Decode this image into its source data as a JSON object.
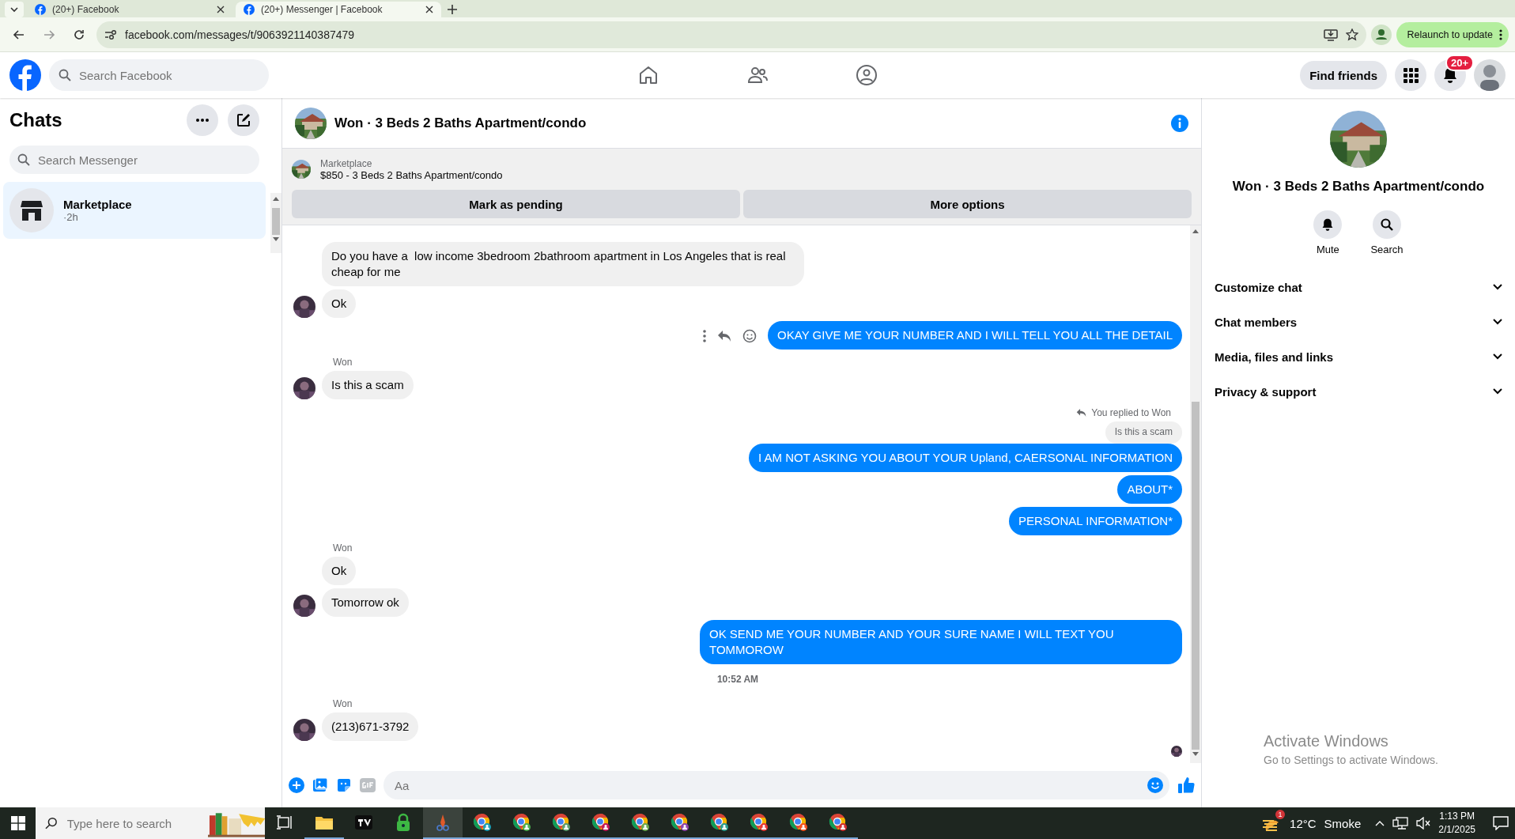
{
  "browser": {
    "tabs": [
      {
        "title": "(20+) Facebook",
        "selected": false
      },
      {
        "title": "(20+) Messenger | Facebook",
        "selected": true
      }
    ],
    "url": "facebook.com/messages/t/9063921140387479",
    "relaunch": "Relaunch to update"
  },
  "topbar": {
    "search_placeholder": "Search Facebook",
    "find_friends": "Find friends",
    "notification_badge": "20+"
  },
  "sidebar": {
    "title": "Chats",
    "search_placeholder": "Search Messenger",
    "chats": [
      {
        "name": "Marketplace",
        "time": "·2h",
        "selected": true
      }
    ]
  },
  "chat": {
    "title": "Won · 3 Beds 2 Baths Apartment/condo",
    "listing": {
      "label": "Marketplace",
      "title": "$850 - 3 Beds 2 Baths Apartment/condo",
      "buttons": [
        "Mark as pending",
        "More options"
      ]
    },
    "messages": [
      {
        "kind": "incoming",
        "text": "Do you have a  low income 3bedroom 2bathroom apartment in Los Angeles that is real cheap for me",
        "avatar": false
      },
      {
        "kind": "incoming",
        "text": "Ok",
        "avatar": true
      },
      {
        "kind": "outgoing",
        "text": "OKAY GIVE ME YOUR NUMBER AND I WILL TELL YOU ALL THE DETAIL",
        "hover_actions": true
      },
      {
        "kind": "sender",
        "text": "Won"
      },
      {
        "kind": "incoming",
        "text": "Is this a scam",
        "avatar": true
      },
      {
        "kind": "reply_note",
        "text": "You replied to Won"
      },
      {
        "kind": "quoted",
        "text": "Is this a scam"
      },
      {
        "kind": "outgoing",
        "text": "I AM NOT ASKING YOU ABOUT YOUR Upland, CAERSONAL INFORMATION",
        "hover_actions": false
      },
      {
        "kind": "outgoing",
        "text": "ABOUT*",
        "hover_actions": false
      },
      {
        "kind": "outgoing",
        "text": "PERSONAL INFORMATION*",
        "hover_actions": false
      },
      {
        "kind": "sender",
        "text": "Won"
      },
      {
        "kind": "incoming",
        "text": "Ok",
        "avatar": false
      },
      {
        "kind": "incoming",
        "text": "Tomorrow ok",
        "avatar": true
      },
      {
        "kind": "outgoing",
        "text": "OK SEND ME YOUR NUMBER AND YOUR SURE NAME I WILL TEXT YOU TOMMOROW",
        "hover_actions": false
      },
      {
        "kind": "timestamp",
        "text": "10:52 AM"
      },
      {
        "kind": "sender",
        "text": "Won"
      },
      {
        "kind": "incoming",
        "text": "(213)671-3792",
        "avatar": true
      },
      {
        "kind": "seen"
      }
    ],
    "composer": {
      "placeholder": "Aa"
    }
  },
  "details": {
    "title": "Won · 3 Beds 2 Baths Apartment/condo",
    "actions": [
      {
        "kind": "mute",
        "label": "Mute"
      },
      {
        "kind": "search",
        "label": "Search"
      }
    ],
    "sections": [
      {
        "label": "Customize chat",
        "expanded": false
      },
      {
        "label": "Chat members",
        "expanded": false
      },
      {
        "label": "Media, files and links",
        "expanded": false
      },
      {
        "label": "Privacy & support",
        "expanded": false
      }
    ]
  },
  "activation": {
    "title": "Activate Windows",
    "text": "Go to Settings to activate Windows."
  },
  "taskbar": {
    "search_placeholder": "Type here to search",
    "weather": {
      "temperature": "12°C",
      "condition": "Smoke",
      "badge": "1"
    },
    "time": "1:13 PM",
    "date": "2/1/2025"
  }
}
